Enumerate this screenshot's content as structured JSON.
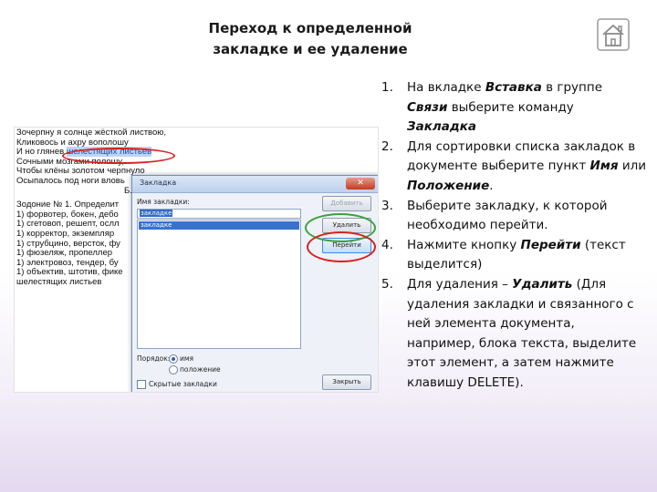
{
  "title": {
    "line1": "Переход к определенной",
    "line2": "закладке и ее удаление"
  },
  "home_icon": "home-icon",
  "document_lines": [
    "Зочерпну я солнце жёсткой листвою,",
    "Кликовось и ахру вополошу",
    "Сочными мозгами полошу,",
    "Чтобы клёны золотом черпнуло",
    "Осыпалось под ноги вловь",
    "Б. Поп",
    "Зодоние № 1. Определит",
    "1) форвотер, бокен, дебо",
    "1) сгетовоп, решепт, ослл",
    "1) корректор, экземпляр",
    "1) струбцино, версток, фу",
    "1) фюзеляж, пропеллер",
    "1) электровоз, тендер, бу",
    "1) объектив, штотив, фике",
    "шелестящих листьев"
  ],
  "document_highlight_line": {
    "before": "И но глянев ",
    "highlight": "шелестящих листьев"
  },
  "dialog": {
    "title": "Закладка",
    "close": "✕",
    "name_label": "Имя закладки:",
    "input_value": "закладке",
    "list_items": [
      "закладке"
    ],
    "buttons": {
      "add": "Добавить",
      "delete": "Удалить",
      "goto": "Перейти"
    },
    "sort_label": "Порядок:",
    "sort_options": [
      "имя",
      "положение"
    ],
    "hidden_label": "Скрытые закладки",
    "cancel": "Закрыть"
  },
  "steps": [
    {
      "num": "1.",
      "parts": [
        "На вкладке ",
        "Вставка",
        " в группе ",
        "Связи",
        " выберите команду ",
        "Закладка"
      ]
    },
    {
      "num": "2.",
      "parts": [
        "Для сортировки списка закладок в документе выберите пункт ",
        "Имя",
        " или ",
        "Положение",
        "."
      ]
    },
    {
      "num": "3.",
      "parts": [
        "Выберите закладку, к которой необходимо перейти."
      ]
    },
    {
      "num": "4.",
      "parts": [
        "Нажмите кнопку ",
        "Перейти",
        " (текст выделится)"
      ]
    },
    {
      "num": "5.",
      "parts": [
        "Для удаления – ",
        "Удалить",
        " (Для удаления закладки и связанного с ней элемента документа, например, блока текста, выделите этот элемент, а затем нажмите клавишу DELETE)."
      ]
    }
  ]
}
